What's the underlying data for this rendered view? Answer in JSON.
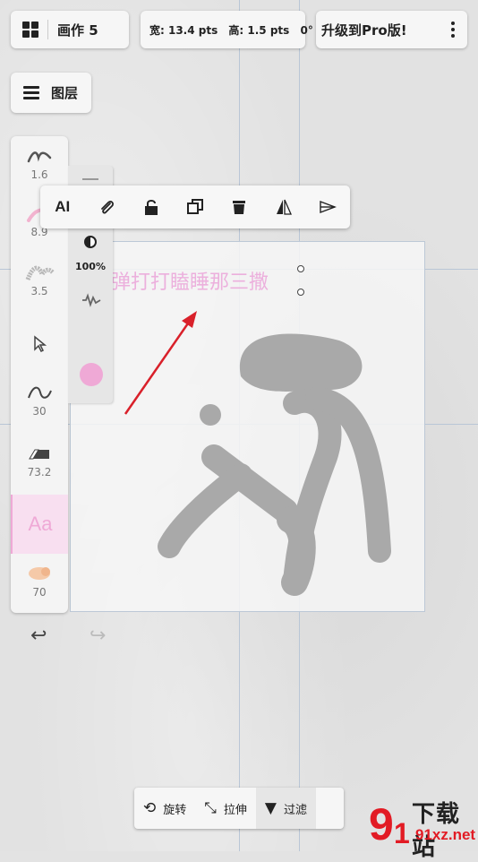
{
  "header": {
    "artwork_title": "画作 5",
    "width_label": "宽: 13.4 pts",
    "height_label": "高: 1.5 pts",
    "angle_label": "0°",
    "upgrade_label": "升级到Pro版!"
  },
  "layers": {
    "label": "图层"
  },
  "sidebar": {
    "tools": [
      {
        "icon": "brush-stroke-icon",
        "value": "1.6"
      },
      {
        "icon": "pink-brush-icon",
        "value": "8.9"
      },
      {
        "icon": "texture-brush-icon",
        "value": "3.5"
      },
      {
        "icon": "select-arrow-icon",
        "value": ""
      },
      {
        "icon": "smoothing-curve-icon",
        "value": "30"
      },
      {
        "icon": "eraser-icon",
        "value": "73.2"
      },
      {
        "icon": "text-tool-icon",
        "value": "Aa"
      },
      {
        "icon": "smudge-blob-icon",
        "value": "70"
      }
    ]
  },
  "subpanel": {
    "opacity_value": "100%",
    "color": "#efa9d6"
  },
  "text_toolbar": {
    "items": [
      "text-edit-icon",
      "attach-icon",
      "lock-icon",
      "duplicate-icon",
      "delete-icon",
      "flip-icon",
      "align-icon"
    ]
  },
  "canvas": {
    "selected_text": "弹打打瞌睡那三撒",
    "text_color": "#efa9d6"
  },
  "bottom_bar": {
    "rotate_label": "旋转",
    "stretch_label": "拉伸",
    "filter_label": "过滤"
  },
  "watermark": {
    "brand": "下载站",
    "domain": "91xz.net"
  }
}
